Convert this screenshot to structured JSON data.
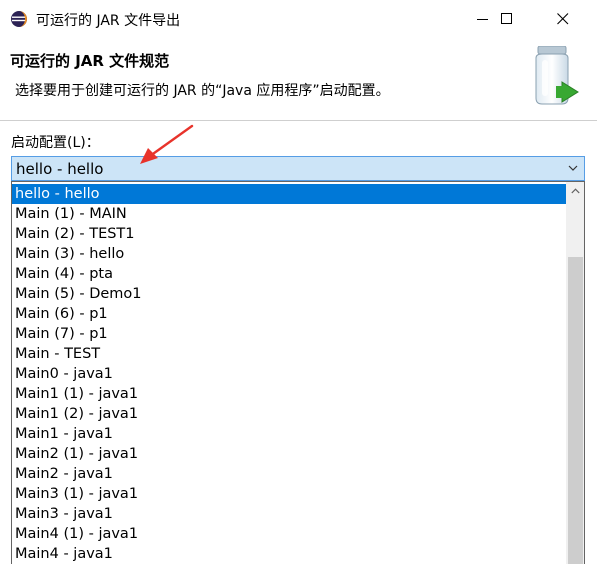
{
  "window": {
    "title": "可运行的 JAR 文件导出"
  },
  "header": {
    "title": "可运行的 JAR 文件规范",
    "description": "选择要用于创建可运行的 JAR 的“Java 应用程序”启动配置。"
  },
  "launch_config": {
    "label": "启动配置(L)：",
    "selected": "hello - hello",
    "options": [
      "hello - hello",
      "Main (1) - MAIN",
      "Main (2) - TEST1",
      "Main (3) - hello",
      "Main (4) - pta",
      "Main (5) - Demo1",
      "Main (6) - p1",
      "Main (7) - p1",
      "Main - TEST",
      "Main0 - java1",
      "Main1 (1) - java1",
      "Main1 (2) - java1",
      "Main1 - java1",
      "Main2 (1) - java1",
      "Main2 - java1",
      "Main3 (1) - java1",
      "Main3 - java1",
      "Main4 (1) - java1",
      "Main4 - java1"
    ]
  },
  "colors": {
    "selection": "#0078d7",
    "combo_bg": "#cce4f7",
    "combo_border": "#569de5",
    "annotation": "#e8332b"
  },
  "icons": {
    "app": "eclipse-icon",
    "header": "jar-export-icon",
    "minimize": "minimize-icon",
    "maximize": "maximize-icon",
    "close": "close-icon",
    "dropdown": "chevron-down-icon",
    "scroll_up": "chevron-up-icon",
    "annotation": "red-arrow-icon"
  }
}
